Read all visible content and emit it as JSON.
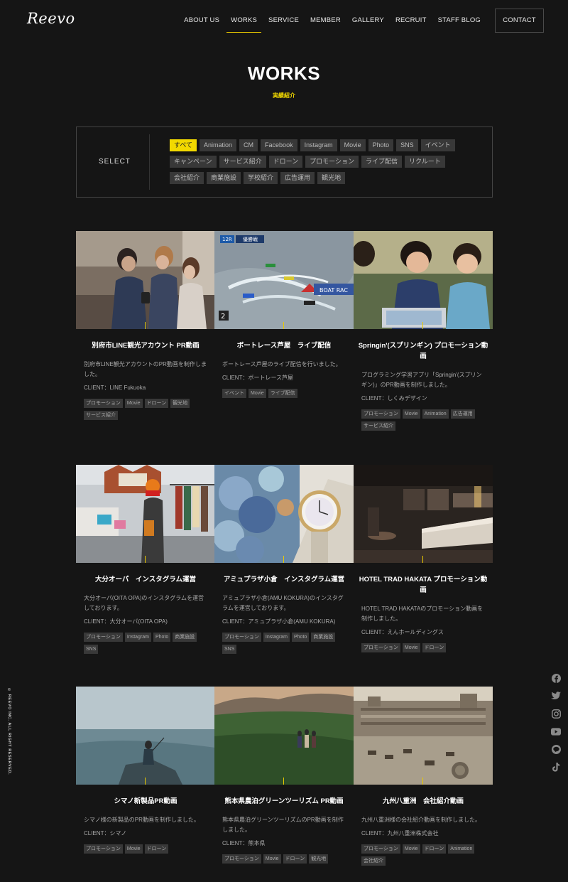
{
  "header": {
    "logo": "Reevo",
    "nav": [
      "ABOUT US",
      "WORKS",
      "SERVICE",
      "MEMBER",
      "GALLERY",
      "RECRUIT",
      "STAFF BLOG"
    ],
    "contact": "CONTACT"
  },
  "page": {
    "title": "WORKS",
    "subtitle": "実績紹介"
  },
  "filter": {
    "label": "SELECT",
    "tags": [
      "すべて",
      "Animation",
      "CM",
      "Facebook",
      "Instagram",
      "Movie",
      "Photo",
      "SNS",
      "イベント",
      "キャンペーン",
      "サービス紹介",
      "ドローン",
      "プロモーション",
      "ライブ配信",
      "リクルート",
      "会社紹介",
      "商業施設",
      "学校紹介",
      "広告運用",
      "観光地"
    ]
  },
  "works": [
    {
      "title": "別府市LINE観光アカウント PR動画",
      "desc": "別府市LINE観光アカウントのPR動画を制作しました。",
      "client": "CLIENT：LINE Fukuoka",
      "tags": [
        "プロモーション",
        "Movie",
        "ドローン",
        "観光地",
        "サービス紹介"
      ]
    },
    {
      "title": "ボートレース芦屋　ライブ配信",
      "desc": "ボートレース芦屋のライブ配信を行いました。",
      "client": "CLIENT：ボートレース芦屋",
      "tags": [
        "イベント",
        "Movie",
        "ライブ配信"
      ]
    },
    {
      "title": "Springin'(スプリンギン) プロモーション動画",
      "desc": "プログラミング学習アプリ「Springin'(スプリンギン)」のPR動画を制作しました。",
      "client": "CLIENT：しくみデザイン",
      "tags": [
        "プロモーション",
        "Movie",
        "Animation",
        "広告運用",
        "サービス紹介"
      ]
    },
    {
      "title": "大分オーパ　インスタグラム運営",
      "desc": "大分オーパ(OITA OPA)のインスタグラムを運営しております。",
      "client": "CLIENT：大分オーパ(OITA OPA)",
      "tags": [
        "プロモーション",
        "Instagram",
        "Photo",
        "商業施設",
        "SNS"
      ]
    },
    {
      "title": "アミュプラザ小倉　インスタグラム運営",
      "desc": "アミュプラザ小倉(AMU KOKURA)のインスタグラムを運営しております。",
      "client": "CLIENT：アミュプラザ小倉(AMU KOKURA)",
      "tags": [
        "プロモーション",
        "Instagram",
        "Photo",
        "商業施設",
        "SNS"
      ]
    },
    {
      "title": "HOTEL TRAD HAKATA プロモーション動画",
      "desc": "HOTEL TRAD HAKATAのプロモーション動画を制作しました。",
      "client": "CLIENT：えんホールディングス",
      "tags": [
        "プロモーション",
        "Movie",
        "ドローン"
      ]
    },
    {
      "title": "シマノ新製品PR動画",
      "desc": "シマノ様の新製品のPR動画を制作しました。",
      "client": "CLIENT：シマノ",
      "tags": [
        "プロモーション",
        "Movie",
        "ドローン"
      ]
    },
    {
      "title": "熊本県農泊グリーンツーリズム PR動画",
      "desc": "熊本県農泊グリーンツーリズムのPR動画を制作しました。",
      "client": "CLIENT：熊本県",
      "tags": [
        "プロモーション",
        "Movie",
        "ドローン",
        "観光地"
      ]
    },
    {
      "title": "九州八重洲　会社紹介動画",
      "desc": "九州八重洲様の会社紹介動画を制作しました。",
      "client": "CLIENT：九州八重洲株式会社",
      "tags": [
        "プロモーション",
        "Movie",
        "ドローン",
        "Animation",
        "会社紹介"
      ]
    }
  ],
  "thumb_text": {
    "race_badge_1": "12R",
    "race_badge_2": "優勝戦",
    "race_sign": "BOAT RAC",
    "race_number": "2"
  },
  "footer": {
    "copyright": "© REEVO INC. ALL RIGHT RESERVED.",
    "social_icons": [
      "facebook-icon",
      "twitter-icon",
      "instagram-icon",
      "youtube-icon",
      "line-icon",
      "tiktok-icon"
    ]
  },
  "colors": {
    "background": "#151515",
    "accent": "#f2d900",
    "tag_bg": "#383838"
  }
}
